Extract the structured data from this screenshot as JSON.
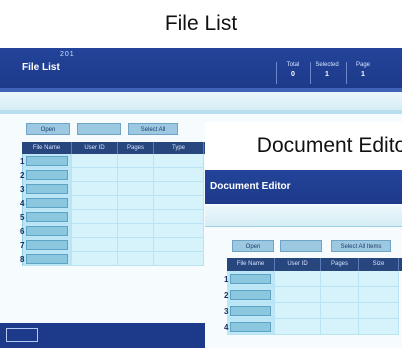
{
  "file_list": {
    "caption": "File List",
    "window_title": "File List",
    "ident": "201",
    "stats": [
      {
        "label": "Total",
        "value": "0"
      },
      {
        "label": "Selected",
        "value": "1"
      },
      {
        "label": "Page",
        "value": "1"
      }
    ],
    "toolbar": {
      "open_label": "Open",
      "blank_label": "",
      "select_all_label": "Select All"
    },
    "columns": [
      "File Name",
      "User ID",
      "Pages",
      "Type"
    ],
    "row_numbers": [
      "1",
      "2",
      "3",
      "4",
      "5",
      "6",
      "7",
      "8"
    ]
  },
  "document_editor": {
    "caption": "Document Editor",
    "window_title": "Document Editor",
    "toolbar": {
      "open_label": "Open",
      "blank_label": "",
      "select_label": "Select All Items"
    },
    "columns": [
      "File Name",
      "User ID",
      "Pages",
      "Size"
    ],
    "row_numbers": [
      "1",
      "2",
      "3",
      "4"
    ]
  },
  "colors": {
    "header": "#1d3a8a",
    "table_header": "#27467d",
    "cell": "#d6f2fb",
    "button": "#9dc8e2"
  }
}
